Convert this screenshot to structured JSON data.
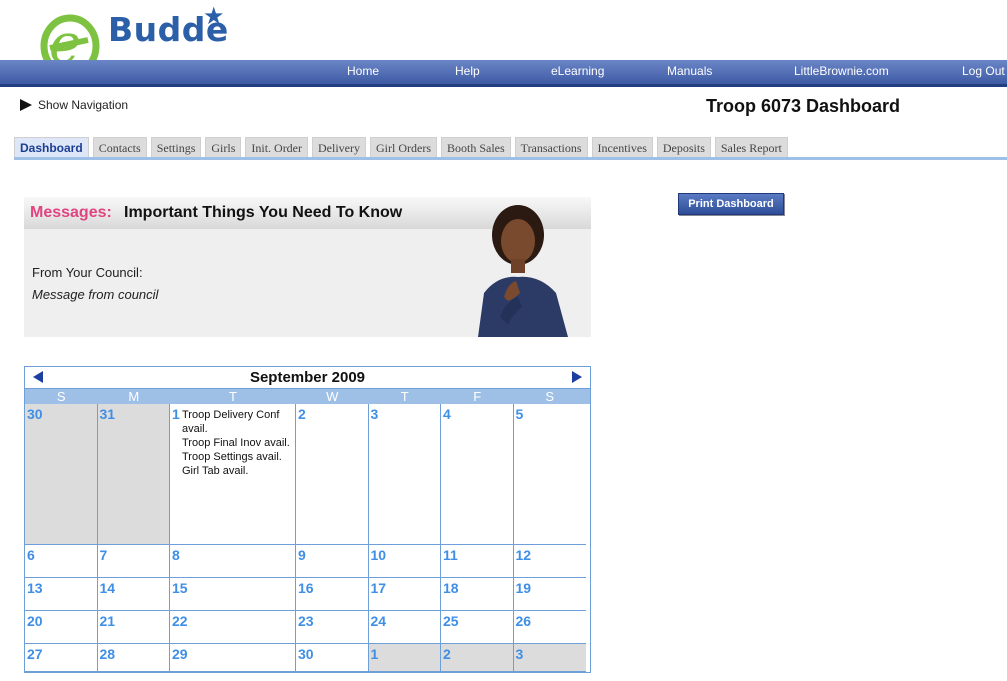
{
  "logo": {
    "text": "Budde"
  },
  "nav": {
    "home": "Home",
    "help": "Help",
    "elearning": "eLearning",
    "manuals": "Manuals",
    "littlebrownie": "LittleBrownie.com",
    "logout": "Log Out"
  },
  "show_navigation": "Show Navigation",
  "page_title": "Troop 6073 Dashboard",
  "tabs": [
    "Dashboard",
    "Contacts",
    "Settings",
    "Girls",
    "Init. Order",
    "Delivery",
    "Girl Orders",
    "Booth Sales",
    "Transactions",
    "Incentives",
    "Deposits",
    "Sales Report"
  ],
  "print_button": "Print Dashboard",
  "messages": {
    "label": "Messages:",
    "heading": "Important Things You Need To Know",
    "from": "From Your Council:",
    "body": "Message from council"
  },
  "calendar": {
    "month": "September 2009",
    "dow": [
      "S",
      "M",
      "T",
      "W",
      "T",
      "F",
      "S"
    ],
    "weeks": [
      [
        {
          "d": "30",
          "other": true
        },
        {
          "d": "31",
          "other": true
        },
        {
          "d": "1",
          "events": [
            "Troop Delivery Conf avail.",
            "Troop Final Inov avail.",
            "Troop Settings avail.",
            "Girl Tab avail."
          ]
        },
        {
          "d": "2"
        },
        {
          "d": "3"
        },
        {
          "d": "4"
        },
        {
          "d": "5"
        }
      ],
      [
        {
          "d": "6"
        },
        {
          "d": "7"
        },
        {
          "d": "8"
        },
        {
          "d": "9"
        },
        {
          "d": "10"
        },
        {
          "d": "11"
        },
        {
          "d": "12"
        }
      ],
      [
        {
          "d": "13"
        },
        {
          "d": "14"
        },
        {
          "d": "15"
        },
        {
          "d": "16"
        },
        {
          "d": "17"
        },
        {
          "d": "18"
        },
        {
          "d": "19"
        }
      ],
      [
        {
          "d": "20"
        },
        {
          "d": "21"
        },
        {
          "d": "22"
        },
        {
          "d": "23"
        },
        {
          "d": "24"
        },
        {
          "d": "25"
        },
        {
          "d": "26"
        }
      ],
      [
        {
          "d": "27"
        },
        {
          "d": "28"
        },
        {
          "d": "29"
        },
        {
          "d": "30"
        },
        {
          "d": "1",
          "other": true
        },
        {
          "d": "2",
          "other": true
        },
        {
          "d": "3",
          "other": true
        }
      ]
    ]
  }
}
